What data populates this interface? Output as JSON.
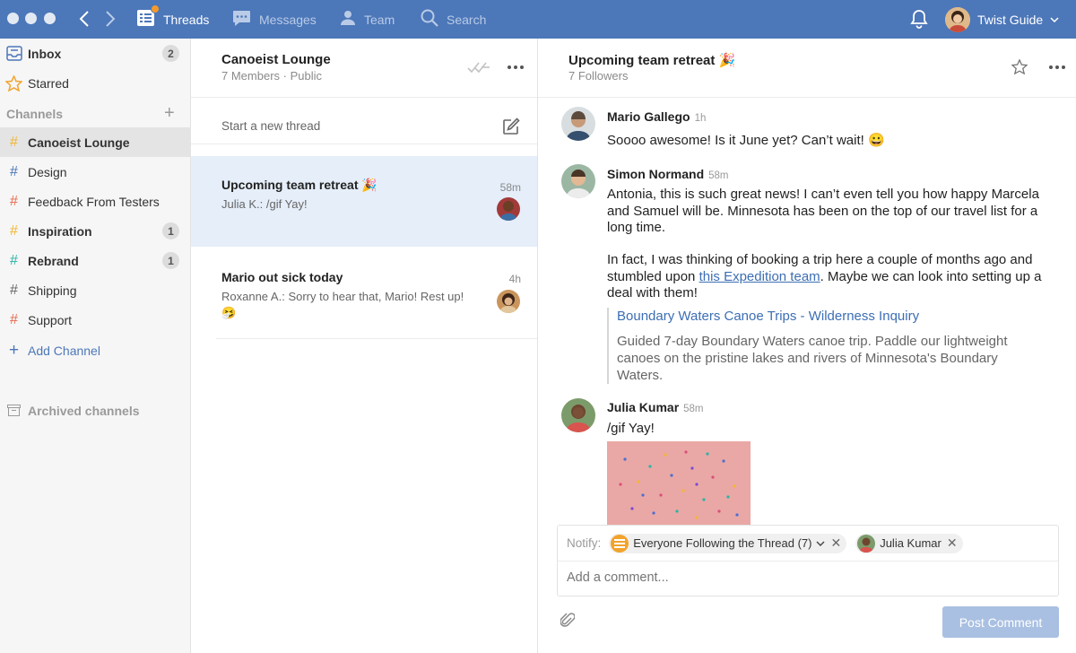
{
  "topbar": {
    "nav": {
      "threads": "Threads",
      "messages": "Messages",
      "team": "Team",
      "search": "Search"
    },
    "user_name": "Twist Guide"
  },
  "sidebar": {
    "inbox": {
      "label": "Inbox",
      "count": "2"
    },
    "starred": {
      "label": "Starred"
    },
    "channels_heading": "Channels",
    "channels": [
      {
        "label": "Canoeist Lounge",
        "color": "#f2b632",
        "count": ""
      },
      {
        "label": "Design",
        "color": "#4c77b9",
        "count": ""
      },
      {
        "label": "Feedback From Testers",
        "color": "#e86a4e",
        "count": ""
      },
      {
        "label": "Inspiration",
        "color": "#f2b632",
        "count": "1"
      },
      {
        "label": "Rebrand",
        "color": "#2bb3a5",
        "count": "1"
      },
      {
        "label": "Shipping",
        "color": "#666666",
        "count": ""
      },
      {
        "label": "Support",
        "color": "#e86a4e",
        "count": ""
      }
    ],
    "add_channel": "Add Channel",
    "archived": "Archived channels"
  },
  "middle": {
    "channel_title": "Canoeist Lounge",
    "channel_sub": "7 Members · Public",
    "new_thread": "Start a new thread",
    "threads": [
      {
        "title": "Upcoming team retreat 🎉",
        "time": "58m",
        "snippet": "Julia K.: /gif Yay!"
      },
      {
        "title": "Mario out sick today",
        "time": "4h",
        "snippet": "Roxanne A.: Sorry to hear that, Mario! Rest up! 🤧"
      }
    ]
  },
  "thread": {
    "title": "Upcoming team retreat 🎉",
    "followers": "7 Followers",
    "messages": [
      {
        "author": "Mario Gallego",
        "time": "1h",
        "text": "Soooo awesome! Is it June yet? Can’t wait! 😀"
      },
      {
        "author": "Simon Normand",
        "time": "58m",
        "p1": "Antonia, this is such great news! I can’t even tell you how happy Marcela and Samuel will be. Minnesota has been on the top of our travel list for a long time.",
        "p2_before": "In fact, I was thinking of booking a trip here a couple of months ago and stumbled upon ",
        "p2_link": "this Expedition team",
        "p2_after": ". Maybe we can look into setting up a deal with them!",
        "quote_title": "Boundary Waters Canoe Trips - Wilderness Inquiry",
        "quote_desc": "Guided 7-day Boundary Waters canoe trip. Paddle our lightweight canoes on the pristine lakes and rivers of Minnesota's Boundary Waters."
      },
      {
        "author": "Julia Kumar",
        "time": "58m",
        "text": "/gif Yay!"
      }
    ]
  },
  "composer": {
    "notify_label": "Notify:",
    "chip_everyone": "Everyone Following the Thread (7)",
    "chip_person": "Julia Kumar",
    "placeholder": "Add a comment...",
    "post_button": "Post Comment"
  }
}
